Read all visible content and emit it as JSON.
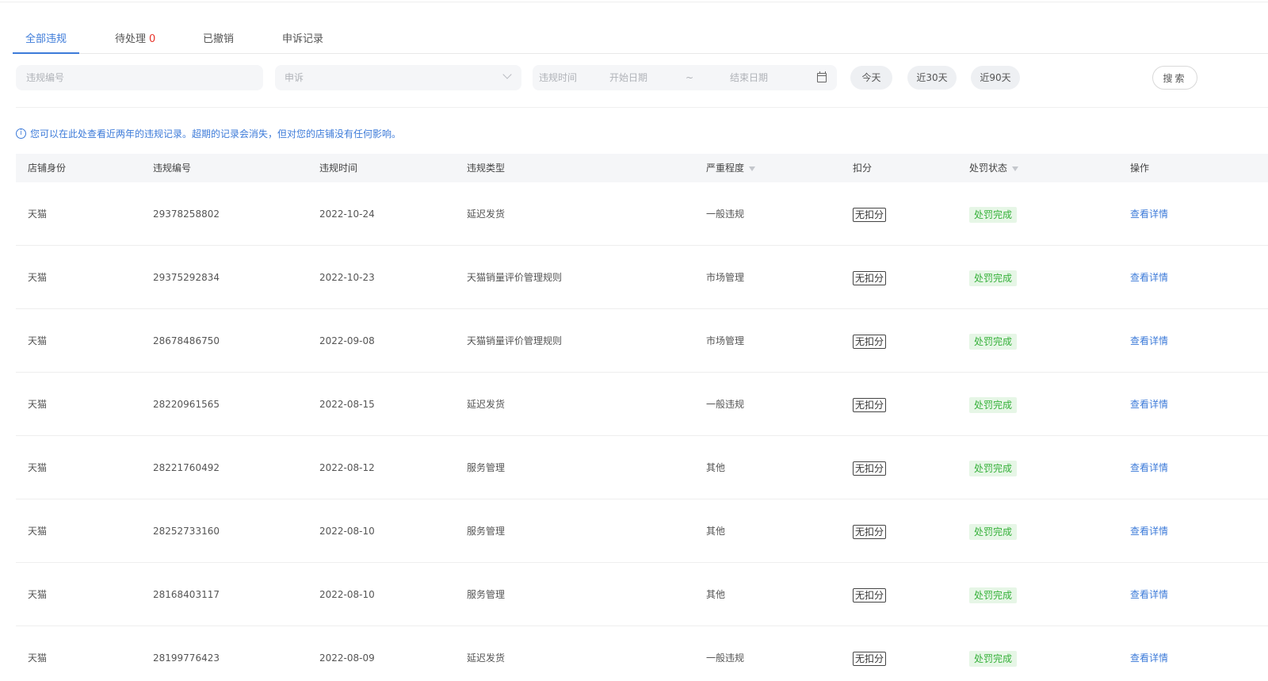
{
  "tabs": [
    {
      "label": "全部违规",
      "count": ""
    },
    {
      "label": "待处理",
      "count": "0"
    },
    {
      "label": "已撤销",
      "count": ""
    },
    {
      "label": "申诉记录",
      "count": ""
    }
  ],
  "filters": {
    "id_placeholder": "违规编号",
    "status_selected": "申诉",
    "time_label": "违规时间",
    "start_placeholder": "开始日期",
    "range_sep": "~",
    "end_placeholder": "结束日期",
    "quick_ranges": [
      "今天",
      "近30天",
      "近90天"
    ],
    "search_label": "搜索"
  },
  "notice": "您可以在此处查看近两年的违规记录。超期的记录会消失，但对您的店铺没有任何影响。",
  "table": {
    "headers": [
      "店铺身份",
      "违规编号",
      "违规时间",
      "违规类型",
      "严重程度",
      "扣分",
      "处罚状态",
      "操作"
    ],
    "rows": [
      {
        "shop": "天猫",
        "id": "29378258802",
        "date": "2022-10-24",
        "type": "延迟发货",
        "severity": "一般违规",
        "points": "无扣分",
        "status": "处罚完成",
        "action": "查看详情"
      },
      {
        "shop": "天猫",
        "id": "29375292834",
        "date": "2022-10-23",
        "type": "天猫销量评价管理规则",
        "severity": "市场管理",
        "points": "无扣分",
        "status": "处罚完成",
        "action": "查看详情"
      },
      {
        "shop": "天猫",
        "id": "28678486750",
        "date": "2022-09-08",
        "type": "天猫销量评价管理规则",
        "severity": "市场管理",
        "points": "无扣分",
        "status": "处罚完成",
        "action": "查看详情"
      },
      {
        "shop": "天猫",
        "id": "28220961565",
        "date": "2022-08-15",
        "type": "延迟发货",
        "severity": "一般违规",
        "points": "无扣分",
        "status": "处罚完成",
        "action": "查看详情"
      },
      {
        "shop": "天猫",
        "id": "28221760492",
        "date": "2022-08-12",
        "type": "服务管理",
        "severity": "其他",
        "points": "无扣分",
        "status": "处罚完成",
        "action": "查看详情"
      },
      {
        "shop": "天猫",
        "id": "28252733160",
        "date": "2022-08-10",
        "type": "服务管理",
        "severity": "其他",
        "points": "无扣分",
        "status": "处罚完成",
        "action": "查看详情"
      },
      {
        "shop": "天猫",
        "id": "28168403117",
        "date": "2022-08-10",
        "type": "服务管理",
        "severity": "其他",
        "points": "无扣分",
        "status": "处罚完成",
        "action": "查看详情"
      },
      {
        "shop": "天猫",
        "id": "28199776423",
        "date": "2022-08-09",
        "type": "延迟发货",
        "severity": "一般违规",
        "points": "无扣分",
        "status": "处罚完成",
        "action": "查看详情"
      }
    ]
  },
  "colors": {
    "accent": "#3d7bd9",
    "danger": "#e8352c",
    "success": "#36b13a",
    "success_bg": "#e6f6e6"
  }
}
